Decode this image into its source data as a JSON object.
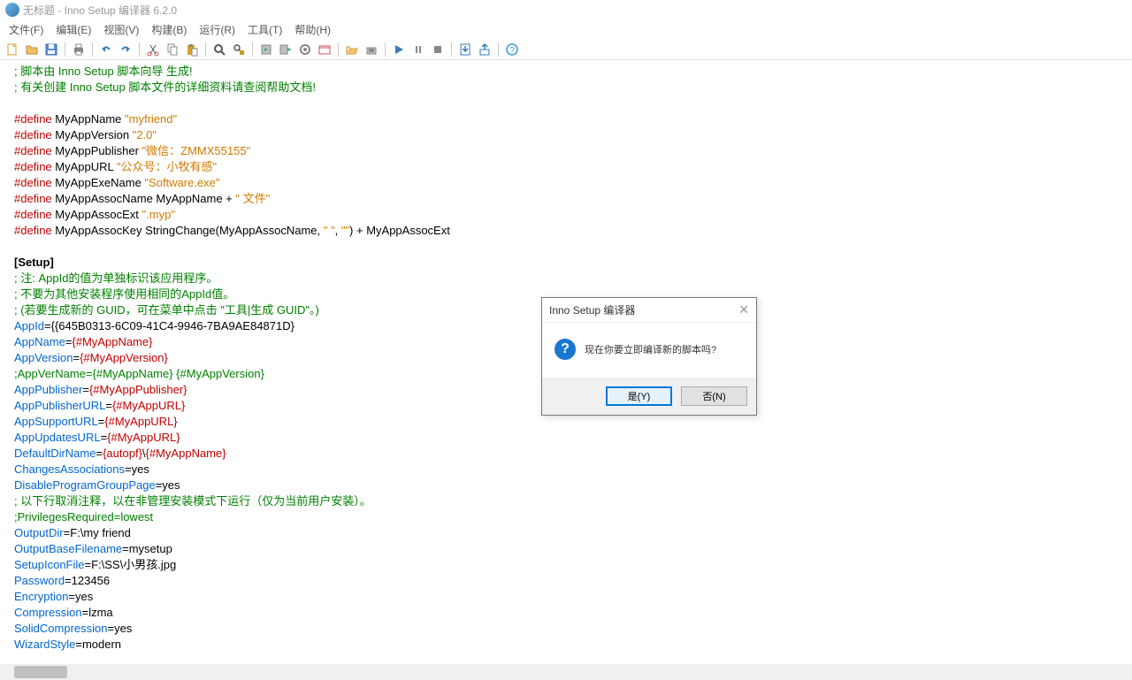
{
  "window": {
    "title": "无标题 - Inno Setup 编译器 6.2.0"
  },
  "menu": {
    "file": "文件(F)",
    "edit": "编辑(E)",
    "view": "视图(V)",
    "build": "构建(B)",
    "run": "运行(R)",
    "tools": "工具(T)",
    "help": "帮助(H)"
  },
  "code": {
    "c1": "; 脚本由 Inno Setup 脚本向导 生成!",
    "c2": "; 有关创建 Inno Setup 脚本文件的详细资料请查阅帮助文档!",
    "d1k": "#define",
    "d1n": " MyAppName ",
    "d1v": "\"myfriend\"",
    "d2k": "#define",
    "d2n": " MyAppVersion ",
    "d2v": "\"2.0\"",
    "d3k": "#define",
    "d3n": " MyAppPublisher ",
    "d3v": "\"微信：ZMMX55155\"",
    "d4k": "#define",
    "d4n": " MyAppURL ",
    "d4v": "\"公众号：小牧有感\"",
    "d5k": "#define",
    "d5n": " MyAppExeName ",
    "d5v": "\"Software.exe\"",
    "d6k": "#define",
    "d6n": " MyAppAssocName MyAppName + ",
    "d6v": "\" 文件\"",
    "d7k": "#define",
    "d7n": " MyAppAssocExt ",
    "d7v": "\".myp\"",
    "d8k": "#define",
    "d8n": " MyAppAssocKey StringChange(MyAppAssocName, ",
    "d8v1": "\" \"",
    "d8c": ", ",
    "d8v2": "\"\"",
    "d8e": ") + MyAppAssocExt",
    "sec": "[Setup]",
    "s1": "; 注: AppId的值为单独标识该应用程序。",
    "s2": "; 不要为其他安装程序使用相同的AppId值。",
    "s3": "; (若要生成新的 GUID，可在菜单中点击 \"工具|生成 GUID\"。)",
    "l1a": "AppId",
    "l1b": "=",
    "l1c": "{{645B0313-6C09-41C4-9946-7BA9AE84871D}",
    "l2a": "AppName",
    "l2b": "=",
    "l2c": "{#MyAppName}",
    "l3a": "AppVersion",
    "l3b": "=",
    "l3c": "{#MyAppVersion}",
    "l4g": ";AppVerName={#MyAppName} {#MyAppVersion}",
    "l5a": "AppPublisher",
    "l5b": "=",
    "l5c": "{#MyAppPublisher}",
    "l6a": "AppPublisherURL",
    "l6b": "=",
    "l6c": "{#MyAppURL}",
    "l7a": "AppSupportURL",
    "l7b": "=",
    "l7c": "{#MyAppURL}",
    "l8a": "AppUpdatesURL",
    "l8b": "=",
    "l8c": "{#MyAppURL}",
    "l9a": "DefaultDirName",
    "l9b": "=",
    "l9c1": "{autopf}",
    "l9c2": "\\",
    "l9c3": "{#MyAppName}",
    "l10a": "ChangesAssociations",
    "l10b": "=",
    "l10c": "yes",
    "l11a": "DisableProgramGroupPage",
    "l11b": "=",
    "l11c": "yes",
    "l12g": "; 以下行取消注释，以在非管理安装模式下运行（仅为当前用户安装）。",
    "l13g": ";PrivilegesRequired=lowest",
    "l14a": "OutputDir",
    "l14b": "=",
    "l14c": "F:\\my friend",
    "l15a": "OutputBaseFilename",
    "l15b": "=",
    "l15c": "mysetup",
    "l16a": "SetupIconFile",
    "l16b": "=",
    "l16c": "F:\\SS\\小男孩.jpg",
    "l17a": "Password",
    "l17b": "=",
    "l17c": "123456",
    "l18a": "Encryption",
    "l18b": "=",
    "l18c": "yes",
    "l19a": "Compression",
    "l19b": "=",
    "l19c": "lzma",
    "l20a": "SolidCompression",
    "l20b": "=",
    "l20c": "yes",
    "l21a": "WizardStyle",
    "l21b": "=",
    "l21c": "modern"
  },
  "dialog": {
    "title": "Inno Setup 编译器",
    "message": "现在你要立即编译新的脚本吗?",
    "yes": "是(Y)",
    "no": "否(N)"
  }
}
